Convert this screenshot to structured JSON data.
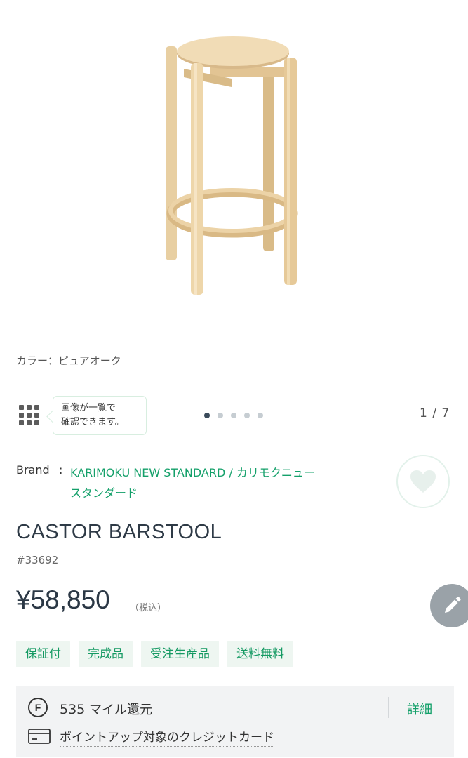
{
  "product_image": {
    "icon": "castor-barstool-photo"
  },
  "color": {
    "label": "カラー：ピュアオーク"
  },
  "gallery": {
    "grid_icon": "grid-icon",
    "tooltip_line1": "画像が一覧で",
    "tooltip_line2": "確認できます。",
    "dots_total": 5,
    "dots_active": 1,
    "pager": "1 / 7"
  },
  "brand": {
    "label": "Brand",
    "separator": ":",
    "line1": "KARIMOKU NEW STANDARD / カリモクニュー",
    "line2": "スタンダード",
    "favorite_icon": "heart-icon"
  },
  "product": {
    "name": "CASTOR BARSTOOL",
    "sku": "#33692",
    "price": "¥58,850",
    "tax_note": "（税込）",
    "edit_icon": "pencil-icon"
  },
  "tags": [
    "保証付",
    "完成品",
    "受注生産品",
    "送料無料"
  ],
  "miles": {
    "f_badge": "F",
    "amount": "535",
    "suffix": " マイル還元",
    "detail_label": "詳細",
    "card_link": "ポイントアップ対象のクレジットカード",
    "card_icon": "credit-card-icon"
  },
  "colors": {
    "accent": "#14a06a",
    "tag_bg": "#eef6f1",
    "box_bg": "#f2f3f4"
  }
}
